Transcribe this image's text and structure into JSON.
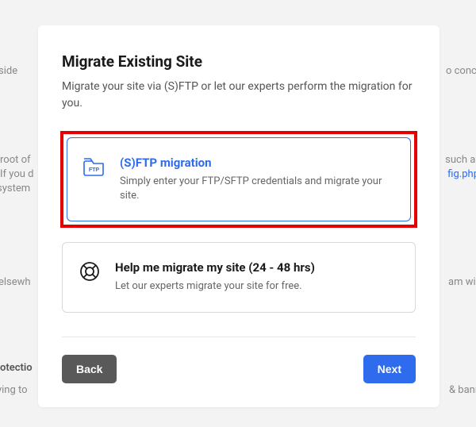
{
  "modal": {
    "title": "Migrate Existing Site",
    "subtitle": "Migrate your site via (S)FTP or let our experts perform the migration for you."
  },
  "options": {
    "sftp": {
      "title": "(S)FTP migration",
      "desc": "Simply enter your FTP/SFTP credentials and migrate your site."
    },
    "help": {
      "title": "Help me migrate my site (24 - 48 hrs)",
      "desc": "Let our experts migrate your site for free."
    }
  },
  "footer": {
    "back": "Back",
    "next": "Next"
  },
  "bg": {
    "t1": "r-side",
    "t2": "o concu",
    "t3": "root of",
    "t4": "If you d",
    "t5": "system",
    "t6": "such as",
    "t7": "fig.php",
    "t8": "elsewh",
    "t9": "am will",
    "t10": "otectio",
    "t11": "ying to",
    "t12": "& bann"
  }
}
